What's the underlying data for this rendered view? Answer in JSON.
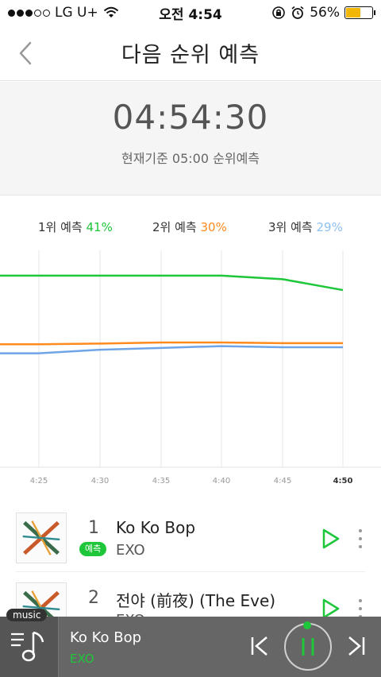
{
  "status_bar": {
    "carrier": "LG U+",
    "time": "오전 4:54",
    "battery_percent": "56%",
    "battery_level": 0.56
  },
  "header": {
    "title": "다음 순위 예측"
  },
  "countdown": {
    "time": "04:54:30",
    "subtitle": "현재기준 05:00 순위예측"
  },
  "legend": [
    {
      "label": "1위 예측",
      "value": "41%",
      "color": "#1ec63a"
    },
    {
      "label": "2위 예측",
      "value": "30%",
      "color": "#ff8a1e"
    },
    {
      "label": "3위 예측",
      "value": "29%",
      "color": "#8ec1f0"
    }
  ],
  "chart_data": {
    "type": "line",
    "x": [
      "4:25",
      "4:30",
      "4:35",
      "4:40",
      "4:45",
      "4:50"
    ],
    "x_highlight": "4:50",
    "ylim": [
      0,
      60
    ],
    "grid": "vertical",
    "series": [
      {
        "color": "#1ec63a",
        "values": [
          53,
          53,
          53,
          53,
          52,
          49
        ]
      },
      {
        "color": "#ff8a1e",
        "values": [
          34,
          34.2,
          34.5,
          34.5,
          34.3,
          34.3
        ]
      },
      {
        "color": "#6fa5e6",
        "values": [
          31.5,
          32.5,
          33,
          33.5,
          33.2,
          33.2
        ]
      }
    ]
  },
  "songs": [
    {
      "rank": "1",
      "title": "Ko Ko Bop",
      "badge": "예측",
      "badge_color": "#1ec63a",
      "artist": "EXO"
    },
    {
      "rank": "2",
      "title": "전야 (前夜) (The Eve)",
      "badge": "",
      "badge_color": "#ff8a1e",
      "artist": "EXO"
    }
  ],
  "player": {
    "tag": "music",
    "title": "Ko Ko Bop",
    "artist": "EXO"
  }
}
